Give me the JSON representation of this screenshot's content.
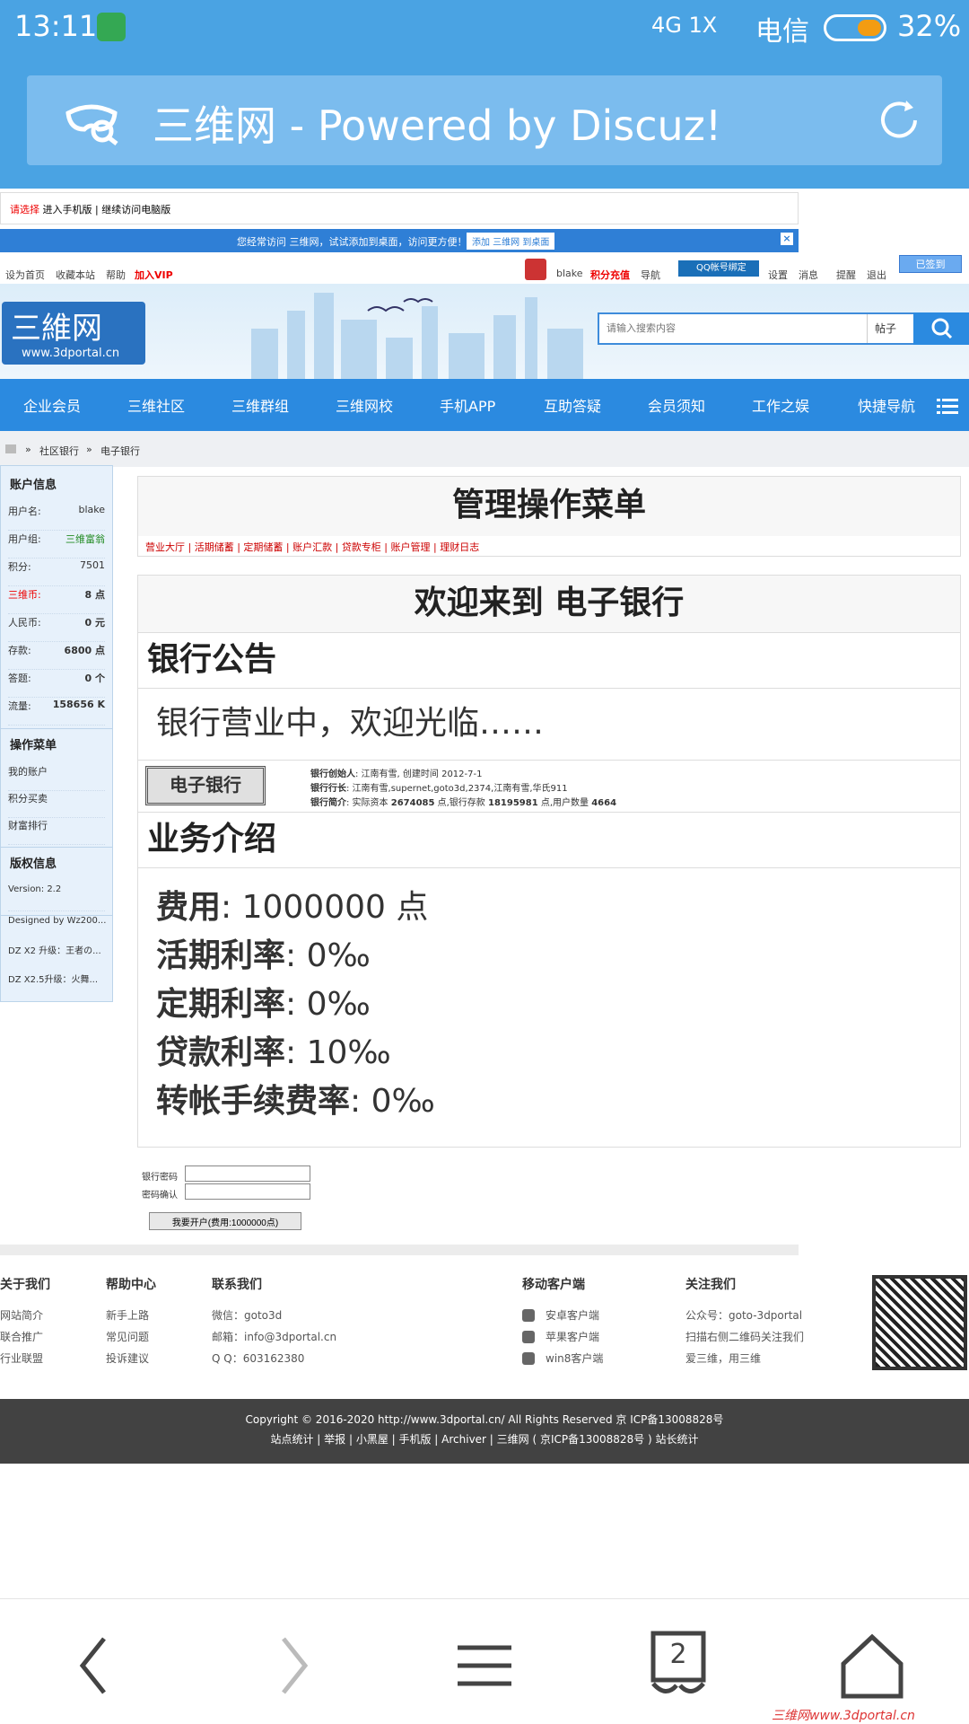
{
  "status": {
    "time": "13:11",
    "signal": "4G 1X",
    "carrier": "电信",
    "battery": "32%"
  },
  "browser": {
    "title": "三维网 - Powered by Discuz!"
  },
  "choose": {
    "prefix": "请选择",
    "mobile": "进入手机版",
    "sep": "|",
    "pc": "继续访问电脑版"
  },
  "promo": {
    "text": "您经常访问 三维网，试试添加到桌面，访问更方便！",
    "button": "添加 三维网 到桌面",
    "close": "×"
  },
  "toplinks": {
    "home": "设为首页",
    "fav": "收藏本站",
    "help": "帮助",
    "vip": "加入VIP",
    "user": "blake",
    "recharge": "积分充值",
    "nav": "导航",
    "qq": "QQ帐号绑定",
    "settings": "设置",
    "msg": "消息",
    "remind": "提醒",
    "logout": "退出",
    "signed": "已签到"
  },
  "logo": {
    "big": "三維网",
    "small": "www.3dportal.cn"
  },
  "search": {
    "placeholder": "请输入搜索内容",
    "category": "帖子"
  },
  "nav": [
    "企业会员",
    "三维社区",
    "三维群组",
    "三维网校",
    "手机APP",
    "互助答疑",
    "会员须知",
    "工作之娱",
    "快捷导航"
  ],
  "crumbs": {
    "a": "社区银行",
    "b": "电子银行",
    "sep": "»"
  },
  "side": {
    "account_head": "账户信息",
    "account": [
      {
        "k": "用户名:",
        "v": "blake"
      },
      {
        "k": "用户组:",
        "v": "三维富翁"
      },
      {
        "k": "积分:",
        "v": "7501"
      },
      {
        "k": "三维币:",
        "v": "8 点"
      },
      {
        "k": "人民币:",
        "v": "0 元"
      },
      {
        "k": "存款:",
        "v": "6800 点"
      },
      {
        "k": "答题:",
        "v": "0 个"
      },
      {
        "k": "流量:",
        "v": "158656 K"
      }
    ],
    "ops_head": "操作菜单",
    "ops": [
      "我的账户",
      "积分买卖",
      "财富排行"
    ],
    "copy_head": "版权信息",
    "copy": [
      "Version: 2.2",
      "Designed by Wz200...",
      "DZ X2 升级：王者の...",
      "DZ X2.5升级：火舞..."
    ]
  },
  "panel": {
    "title": "管理操作菜单",
    "links": [
      "营业大厅",
      "活期储蓄",
      "定期储蓄",
      "账户汇款",
      "贷款专柜",
      "账户管理",
      "理财日志"
    ]
  },
  "bank": {
    "welcome": "欢迎来到 电子银行",
    "ann_head": "银行公告",
    "ann_text": "银行营业中，欢迎光临……",
    "img_text": "电子银行",
    "l1k": "银行创始人",
    "l1v": ": 江南有雪, 创建时间 2012-7-1",
    "l2k": "银行行长",
    "l2v": ": 江南有雪,supernet,goto3d,2374,江南有雪,华氏911",
    "l3k": "银行简介",
    "l3a": ": 实际资本 ",
    "l3b": "2674085",
    "l3c": " 点,银行存款 ",
    "l3d": "18195981",
    "l3e": " 点,用户数量 ",
    "l3f": "4664",
    "biz_head": "业务介绍",
    "biz": [
      {
        "k": "费用",
        "v": ": 1000000 点"
      },
      {
        "k": "活期利率",
        "v": ": 0‰"
      },
      {
        "k": "定期利率",
        "v": ": 0‰"
      },
      {
        "k": "贷款利率",
        "v": ": 10‰"
      },
      {
        "k": "转帐手续费率",
        "v": ": 0‰"
      }
    ]
  },
  "form": {
    "pw": "银行密码",
    "pw2": "密码确认",
    "submit": "我要开户(费用:1000000点)"
  },
  "footer": {
    "about": {
      "h": "关于我们",
      "l": [
        "网站简介",
        "联合推广",
        "行业联盟"
      ]
    },
    "help": {
      "h": "帮助中心",
      "l": [
        "新手上路",
        "常见问题",
        "投诉建议"
      ]
    },
    "contact": {
      "h": "联系我们",
      "l": [
        "微信：goto3d",
        "邮箱：info@3dportal.cn",
        "Q  Q：603162380"
      ]
    },
    "mobile": {
      "h": "移动客户端",
      "l": [
        "安卓客户端",
        "苹果客户端",
        "win8客户端"
      ]
    },
    "follow": {
      "h": "关注我们",
      "l": [
        "公众号：goto-3dportal",
        "扫描右侧二维码关注我们",
        "爱三维，用三维"
      ]
    }
  },
  "copyright": {
    "l1": "Copyright © 2016-2020 http://www.3dportal.cn/ All Rights Reserved 京 ICP备13008828号",
    "l2": "站点统计 | 举报 | 小黑屋 | 手机版 | Archiver | 三维网 ( 京ICP备13008828号 ) 站长统计"
  },
  "tabs": {
    "count": "2"
  },
  "watermark": "三维网www.3dportal.cn",
  "colors": {
    "primary": "#2b8ae0",
    "accent_red": "#e00000",
    "status_green": "#228b22"
  }
}
